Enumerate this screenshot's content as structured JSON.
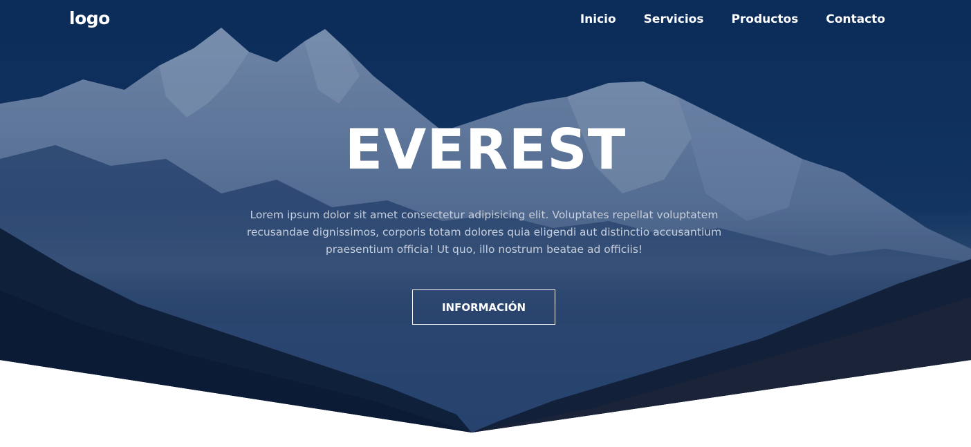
{
  "navbar": {
    "logo": "logo",
    "links": [
      "Inicio",
      "Servicios",
      "Productos",
      "Contacto"
    ]
  },
  "hero": {
    "title": "EVEREST",
    "description": "Lorem ipsum dolor sit amet consectetur adipisicing elit. Voluptates repellat voluptatem recusandae dignissimos, corporis totam dolores quia eligendi aut distinctio accusantium praesentium officia! Ut quo, illo nostrum beatae ad officiis!",
    "button_label": "INFORMACIÓN"
  },
  "colors": {
    "overlay": "#0d2a55",
    "text": "#ffffff",
    "muted_text": "#c8cfdc",
    "background": "#ffffff"
  }
}
